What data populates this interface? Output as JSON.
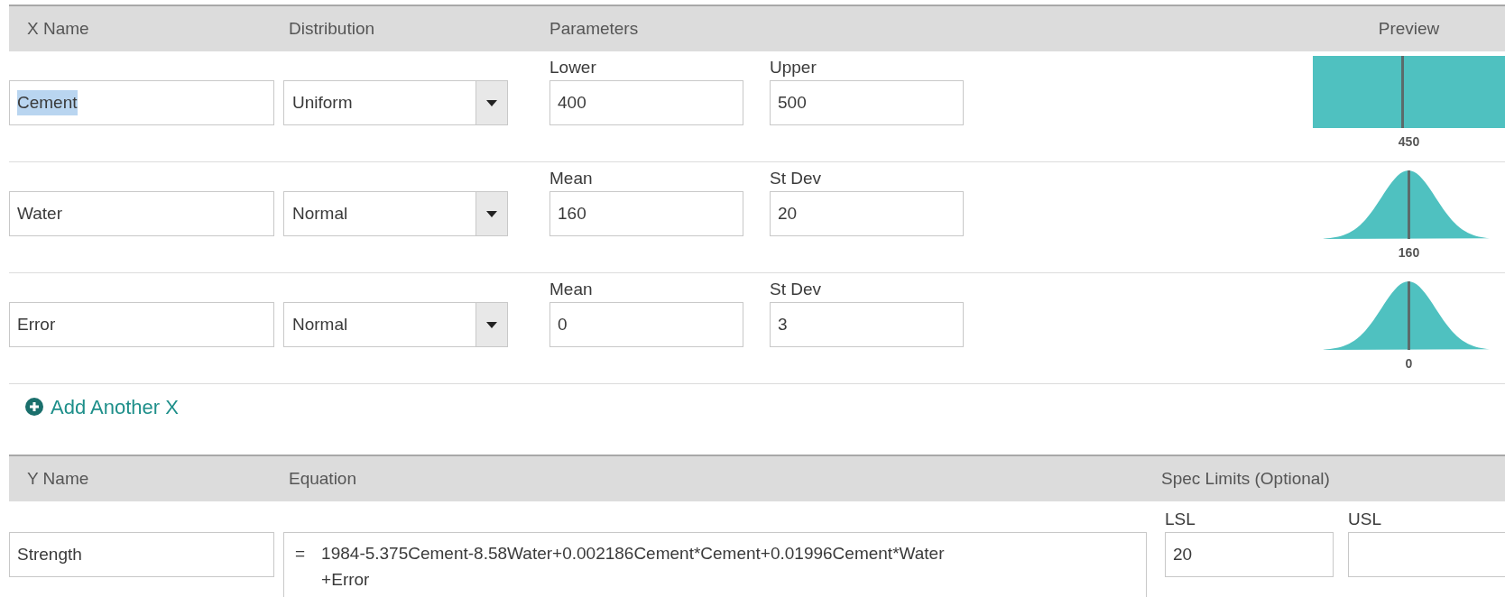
{
  "x_header": {
    "name": "X Name",
    "distribution": "Distribution",
    "parameters": "Parameters",
    "preview": "Preview"
  },
  "x_rows": [
    {
      "name": "Cement",
      "name_selected": true,
      "distribution": "Uniform",
      "params": [
        {
          "label": "Lower",
          "value": "400"
        },
        {
          "label": "Upper",
          "value": "500"
        }
      ],
      "preview": {
        "kind": "uniform",
        "center_label": "450"
      }
    },
    {
      "name": "Water",
      "name_selected": false,
      "distribution": "Normal",
      "params": [
        {
          "label": "Mean",
          "value": "160"
        },
        {
          "label": "St Dev",
          "value": "20"
        }
      ],
      "preview": {
        "kind": "normal",
        "center_label": "160"
      }
    },
    {
      "name": "Error",
      "name_selected": false,
      "distribution": "Normal",
      "params": [
        {
          "label": "Mean",
          "value": "0"
        },
        {
          "label": "St Dev",
          "value": "3"
        }
      ],
      "preview": {
        "kind": "normal",
        "center_label": "0"
      }
    }
  ],
  "add_x": "Add Another X",
  "y_header": {
    "name": "Y Name",
    "equation": "Equation",
    "spec_limits": "Spec Limits (Optional)"
  },
  "y_row": {
    "name": "Strength",
    "equals": "=",
    "equation_lines": [
      "1984-5.375Cement-8.58Water+0.002186Cement*Cement+0.01996Cement*Water",
      "+Error"
    ],
    "limits": [
      {
        "label": "LSL",
        "value": "20"
      },
      {
        "label": "USL"
      }
    ]
  }
}
